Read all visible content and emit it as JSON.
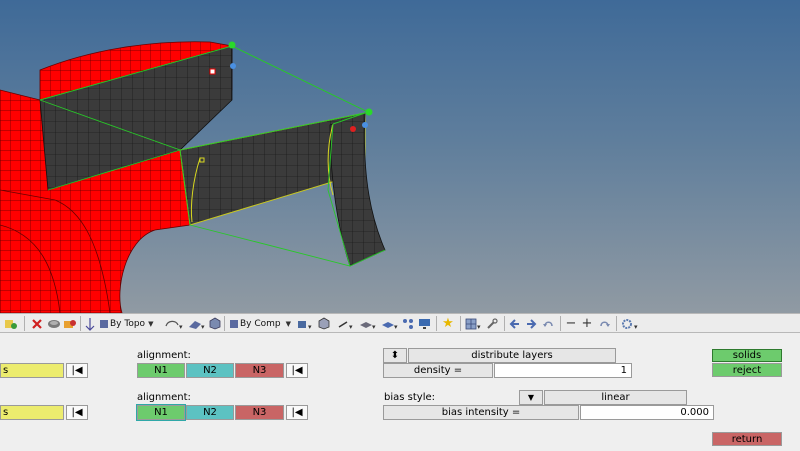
{
  "toolbar": {
    "topo_select": "By Topo",
    "comp_select": "By Comp"
  },
  "panel": {
    "row1": {
      "left_field_text": "s",
      "alignment_label": "alignment:",
      "n1": "N1",
      "n2": "N2",
      "n3": "N3"
    },
    "row2": {
      "left_field_text": "s",
      "alignment_label": "alignment:",
      "n1": "N1",
      "n2": "N2",
      "n3": "N3"
    },
    "distribute_label": "distribute layers",
    "density_label": "density =",
    "density_value": "1",
    "bias_style_label": "bias style:",
    "bias_style_value": "linear",
    "bias_intensity_label": "bias intensity =",
    "bias_intensity_value": "0.000",
    "solids_label": "solids",
    "reject_label": "reject",
    "return_label": "return"
  },
  "colors": {
    "accent_green": "#6dcb6d",
    "accent_cyan": "#5cc2c2",
    "accent_red": "#c96565",
    "accent_yellow": "#ecec6e",
    "mesh_red": "#ff0000",
    "mesh_dark": "#3a3a3a"
  }
}
